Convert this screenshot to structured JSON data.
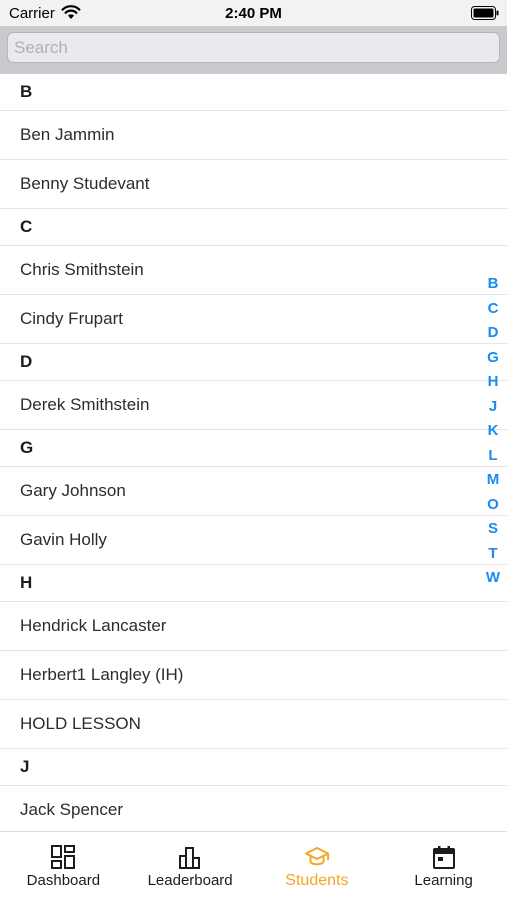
{
  "status_bar": {
    "carrier": "Carrier",
    "time": "2:40 PM"
  },
  "search": {
    "placeholder": "Search",
    "value": ""
  },
  "sections": [
    {
      "letter": "B",
      "items": [
        "Ben Jammin",
        "Benny Studevant"
      ]
    },
    {
      "letter": "C",
      "items": [
        "Chris Smithstein",
        "Cindy Frupart"
      ]
    },
    {
      "letter": "D",
      "items": [
        "Derek Smithstein"
      ]
    },
    {
      "letter": "G",
      "items": [
        "Gary Johnson",
        "Gavin Holly"
      ]
    },
    {
      "letter": "H",
      "items": [
        "Hendrick Lancaster",
        "Herbert1 Langley (IH)",
        "HOLD LESSON"
      ]
    },
    {
      "letter": "J",
      "items": [
        "Jack Spencer"
      ]
    }
  ],
  "index": [
    "B",
    "C",
    "D",
    "G",
    "H",
    "J",
    "K",
    "L",
    "M",
    "O",
    "S",
    "T",
    "W"
  ],
  "tabs": [
    {
      "label": "Dashboard",
      "icon": "dashboard-icon",
      "active": false
    },
    {
      "label": "Leaderboard",
      "icon": "leaderboard-icon",
      "active": false
    },
    {
      "label": "Students",
      "icon": "graduation-cap-icon",
      "active": true
    },
    {
      "label": "Learning",
      "icon": "calendar-icon",
      "active": false
    }
  ],
  "colors": {
    "accent": "#f5a623",
    "index_blue": "#1a8cf0",
    "icon_dark": "#1c1c1e"
  }
}
